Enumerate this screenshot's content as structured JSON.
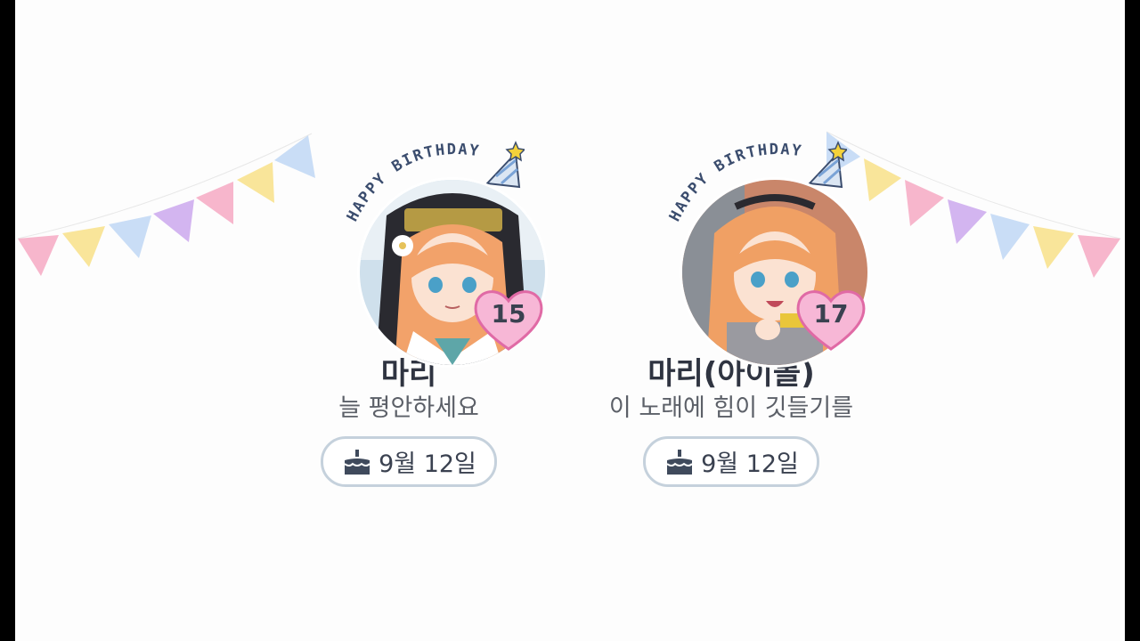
{
  "banner_text": "HAPPY BIRTHDAY",
  "colors": {
    "background": "#fdfdfd",
    "pill_border": "#c5d1dc",
    "heart_fill": "#f7b7d6",
    "heart_stroke": "#e06aa5",
    "name_color": "#2f3441",
    "subtitle_color": "#5c6068"
  },
  "flags": [
    "pink",
    "yellow",
    "light-blue",
    "lavender"
  ],
  "cards": [
    {
      "name": "마리",
      "subtitle": "늘 평안하세요",
      "level": "15",
      "date": "9월 12일",
      "icon": "cake-icon"
    },
    {
      "name": "마리(아이돌)",
      "subtitle": "이 노래에 힘이 깃들기를",
      "level": "17",
      "date": "9월 12일",
      "icon": "cake-icon"
    }
  ]
}
